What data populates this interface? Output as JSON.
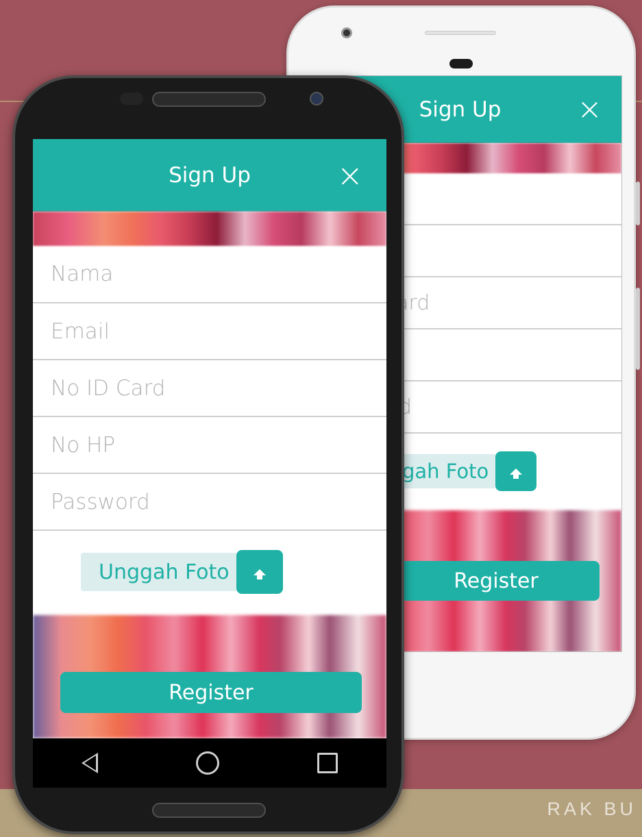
{
  "colors": {
    "background": "#a0535c",
    "accent": "#1fb1a5",
    "band": "#b4a27e",
    "placeholder": "#b3b3b3"
  },
  "footer": {
    "brand": "RAK BU"
  },
  "front_screen": {
    "title": "Sign Up",
    "close_icon": "×",
    "fields": [
      {
        "placeholder": "Nama"
      },
      {
        "placeholder": "Email"
      },
      {
        "placeholder": "No ID Card"
      },
      {
        "placeholder": "No HP"
      },
      {
        "placeholder": "Password"
      }
    ],
    "upload_label": "Unggah Foto",
    "upload_icon": "upload-arrow-icon",
    "register_label": "Register"
  },
  "back_screen": {
    "title": "Sign Up",
    "close_icon": "×",
    "fields": [
      {
        "placeholder": ""
      },
      {
        "placeholder": ""
      },
      {
        "placeholder": "ard"
      },
      {
        "placeholder": ""
      },
      {
        "placeholder": "d"
      }
    ],
    "upload_label": "gah Foto",
    "upload_icon": "upload-arrow-icon",
    "register_label": "Register"
  },
  "navbar": {
    "back_icon": "back-triangle-icon",
    "home_icon": "home-circle-icon",
    "recent_icon": "recent-square-icon"
  }
}
